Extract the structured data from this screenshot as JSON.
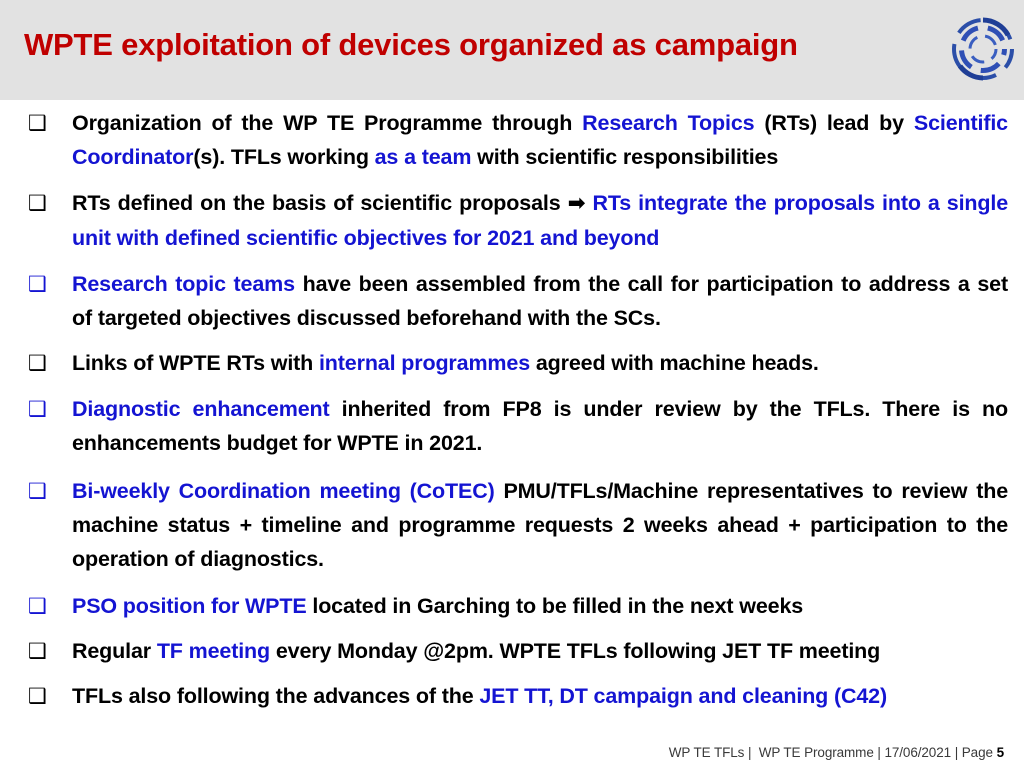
{
  "slide": {
    "title": "WPTE exploitation of devices organized as campaign",
    "title_color": "#C00000",
    "header_background": "#E2E2E2",
    "accent_blue": "#1414D2",
    "logo_name": "eurofusion-rings-logo"
  },
  "bullets": [
    {
      "marker": "❑",
      "marker_color": "black",
      "segments": [
        {
          "text": "Organization of the WP TE Programme through ",
          "style": "normal"
        },
        {
          "text": "Research Topics",
          "style": "highlight"
        },
        {
          "text": " (RTs) lead by ",
          "style": "normal"
        },
        {
          "text": "Scientific Coordinator",
          "style": "highlight"
        },
        {
          "text": "(s). TFLs working ",
          "style": "normal"
        },
        {
          "text": "as a team",
          "style": "highlight"
        },
        {
          "text": " with scientific responsibilities",
          "style": "normal"
        }
      ]
    },
    {
      "marker": "❑",
      "marker_color": "black",
      "segments": [
        {
          "text": " RTs defined on the basis of scientific proposals ",
          "style": "normal"
        },
        {
          "text": "➡",
          "style": "arrow"
        },
        {
          "text": " ",
          "style": "normal"
        },
        {
          "text": "RTs integrate the proposals into a single unit with defined scientific objectives for 2021 and beyond",
          "style": "highlight"
        }
      ]
    },
    {
      "marker": "❑",
      "marker_color": "blue",
      "segments": [
        {
          "text": "Research topic teams",
          "style": "highlight"
        },
        {
          "text": " have been assembled from the call for participation to address a set of targeted objectives discussed beforehand with the SCs.",
          "style": "normal"
        }
      ]
    },
    {
      "marker": "❑",
      "marker_color": "black",
      "segments": [
        {
          "text": "Links of WPTE RTs with ",
          "style": "normal"
        },
        {
          "text": "internal programmes",
          "style": "highlight"
        },
        {
          "text": " agreed with machine heads.",
          "style": "normal"
        }
      ]
    },
    {
      "marker": "❑",
      "marker_color": "blue",
      "segments": [
        {
          "text": "Diagnostic enhancement",
          "style": "highlight"
        },
        {
          "text": " inherited from FP8 is under review by the TFLs. There is no enhancements budget for WPTE in 2021.",
          "style": "normal"
        }
      ]
    },
    {
      "marker": "❑",
      "marker_color": "blue",
      "segments": [
        {
          "text": "Bi-weekly Coordination meeting (CoTEC)",
          "style": "highlight"
        },
        {
          "text": " PMU/TFLs/Machine representatives to review the machine status + timeline and programme requests 2 weeks ahead + participation to the operation of diagnostics.",
          "style": "normal"
        }
      ]
    },
    {
      "marker": "❑",
      "marker_color": "blue",
      "segments": [
        {
          "text": "PSO position for WPTE",
          "style": "highlight"
        },
        {
          "text": " located in Garching to be filled in the next weeks",
          "style": "normal"
        }
      ]
    },
    {
      "marker": "❑",
      "marker_color": "black",
      "segments": [
        {
          "text": "Regular ",
          "style": "normal"
        },
        {
          "text": "TF meeting",
          "style": "highlight"
        },
        {
          "text": " every Monday @2pm. WPTE TFLs following JET TF meeting",
          "style": "normal"
        }
      ]
    },
    {
      "marker": "❑",
      "marker_color": "black",
      "segments": [
        {
          "text": "TFLs also following the advances of the ",
          "style": "normal"
        },
        {
          "text": "JET TT, DT campaign and cleaning (C42)",
          "style": "highlight"
        }
      ]
    }
  ],
  "footer": {
    "author": "WP TE TFLs",
    "programme": "WP TE Programme",
    "date": "17/06/2021",
    "page_label": "Page",
    "page_number": "5",
    "separator": "|"
  }
}
